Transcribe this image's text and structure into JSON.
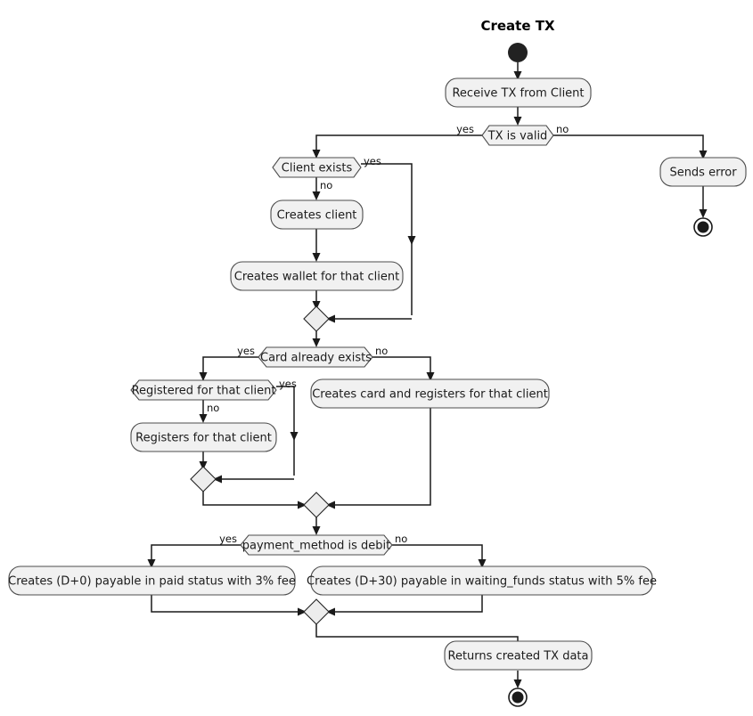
{
  "diagram": {
    "title": "Create TX",
    "type": "uml-activity-diagram",
    "colors": {
      "node_fill": "#F1F1F1",
      "node_stroke": "#4D4D4D",
      "line": "#1A1A1A",
      "text": "#1B1B1B",
      "background": "#FFFFFF"
    },
    "start_node": {
      "name": "start"
    },
    "activities": [
      {
        "id": "receive_tx",
        "label": "Receive TX from Client"
      },
      {
        "id": "sends_error",
        "label": "Sends error"
      },
      {
        "id": "creates_client",
        "label": "Creates client"
      },
      {
        "id": "creates_wallet",
        "label": "Creates wallet for that client"
      },
      {
        "id": "creates_card",
        "label": "Creates card and registers for that client"
      },
      {
        "id": "registers_client",
        "label": "Registers for that client"
      },
      {
        "id": "payable_d0",
        "label": "Creates (D+0) payable in paid status with 3% fee"
      },
      {
        "id": "payable_d30",
        "label": "Creates (D+30) payable in waiting_funds status with 5% fee"
      },
      {
        "id": "returns_tx",
        "label": "Returns created TX data"
      }
    ],
    "decisions": [
      {
        "id": "tx_is_valid",
        "label": "TX is valid",
        "yes_label": "yes",
        "no_label": "no"
      },
      {
        "id": "client_exists",
        "label": "Client exists",
        "yes_label": "yes",
        "no_label": "no"
      },
      {
        "id": "card_already_exists",
        "label": "Card already exists",
        "yes_label": "yes",
        "no_label": "no"
      },
      {
        "id": "registered_for_client",
        "label": "Registered for that client",
        "yes_label": "yes",
        "no_label": "no"
      },
      {
        "id": "payment_method_is_debit",
        "label": "payment_method is debit",
        "yes_label": "yes",
        "no_label": "no"
      }
    ],
    "merges": [
      {
        "id": "merge_client"
      },
      {
        "id": "merge_register"
      },
      {
        "id": "merge_card"
      },
      {
        "id": "merge_payable"
      }
    ],
    "end_nodes": [
      {
        "id": "end_error"
      },
      {
        "id": "end_success"
      }
    ]
  }
}
